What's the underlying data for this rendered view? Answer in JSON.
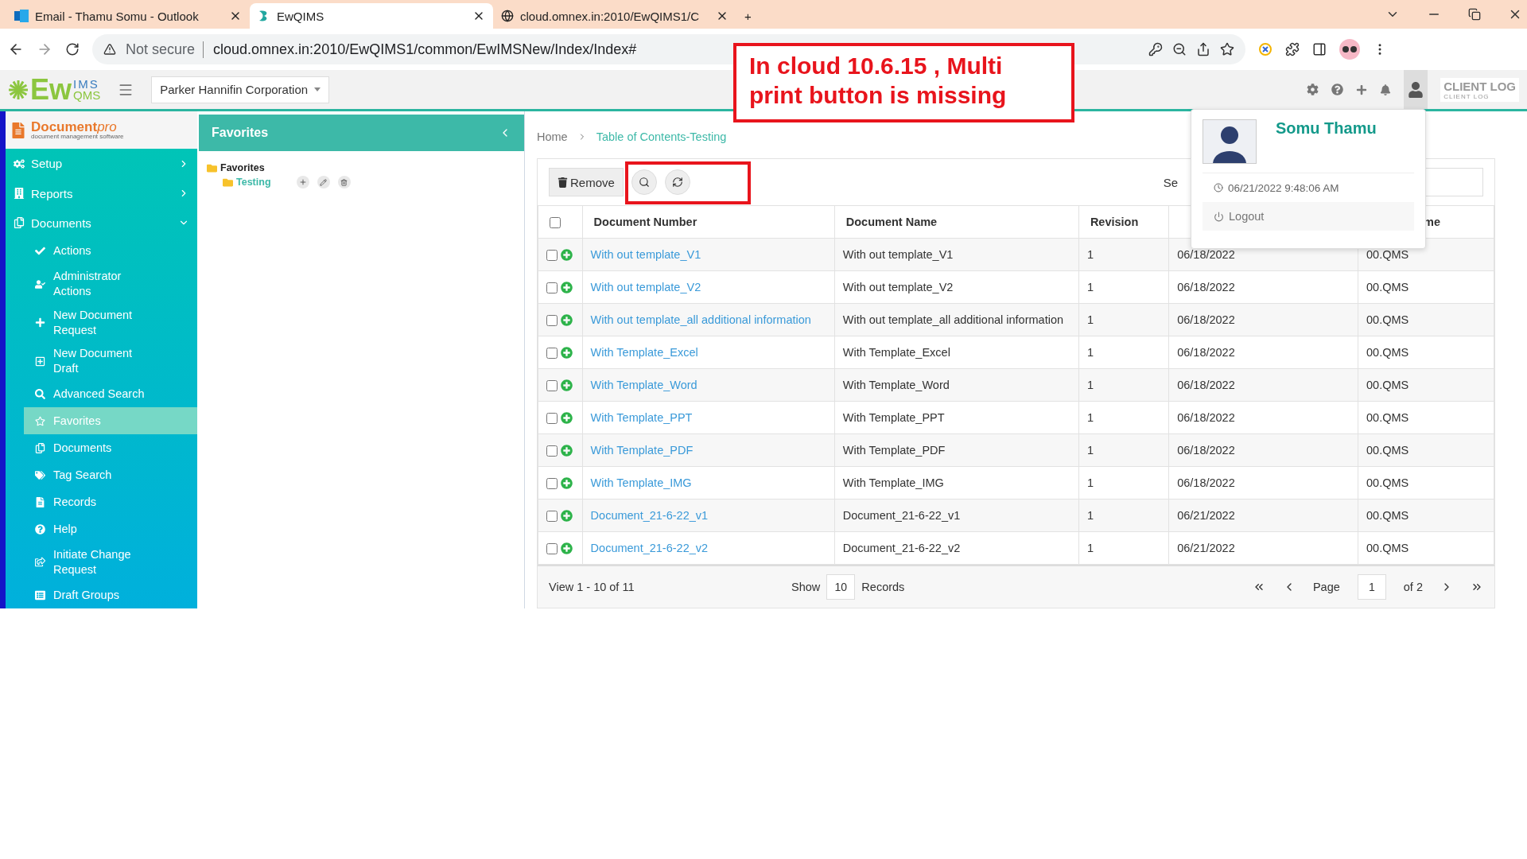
{
  "browser": {
    "tabs": [
      {
        "title": "Email - Thamu Somu - Outlook",
        "selected": false
      },
      {
        "title": "EwQIMS",
        "selected": true
      },
      {
        "title": "cloud.omnex.in:2010/EwQIMS1/C",
        "selected": false
      }
    ],
    "new_tab": "+",
    "security": "Not secure",
    "url": "cloud.omnex.in:2010/EwQIMS1/common/EwIMSNew/Index/Index#"
  },
  "annotation": {
    "text": "In cloud 10.6.15 , Multi print button is missing"
  },
  "header": {
    "logo": {
      "main": "Ew",
      "top": "IMS",
      "bottom": "QMS"
    },
    "company": "Parker Hannifin Corporation",
    "client_logo": "CLIENT LOG",
    "client_logo_tagline": "CLIENT LOG"
  },
  "sidebar": {
    "brand": {
      "name": "Document",
      "suffix": "pro",
      "tagline": "document management software"
    },
    "items": [
      {
        "label": "Setup",
        "expanded": false
      },
      {
        "label": "Reports",
        "expanded": false
      },
      {
        "label": "Documents",
        "expanded": true,
        "children": [
          {
            "label": "Actions",
            "selected": false
          },
          {
            "label": "Administrator Actions",
            "selected": false
          },
          {
            "label": "New Document Request",
            "selected": false
          },
          {
            "label": "New Document Draft",
            "selected": false
          },
          {
            "label": "Advanced Search",
            "selected": false
          },
          {
            "label": "Favorites",
            "selected": true
          },
          {
            "label": "Documents",
            "selected": false
          },
          {
            "label": "Tag Search",
            "selected": false
          },
          {
            "label": "Records",
            "selected": false
          },
          {
            "label": "Help",
            "selected": false
          },
          {
            "label": "Initiate Change Request",
            "selected": false
          },
          {
            "label": "Draft Groups",
            "selected": false
          }
        ]
      }
    ]
  },
  "favorites_panel": {
    "title": "Favorites",
    "tree": [
      {
        "label": "Favorites",
        "children": [
          {
            "label": "Testing"
          }
        ]
      }
    ]
  },
  "breadcrumb": [
    "Home",
    "Table of Contents-Testing"
  ],
  "toolbar": {
    "remove": "Remove",
    "search_label": "Se"
  },
  "table": {
    "select_all_checked": false,
    "columns": [
      {
        "label": "Document Number"
      },
      {
        "label": "Document Name"
      },
      {
        "label": "Revision"
      },
      {},
      {
        "label": "me"
      }
    ],
    "rows": [
      {
        "checked": false,
        "cells": [
          "With out template_V1",
          "With out template_V1",
          "1",
          "06/18/2022",
          "00.QMS"
        ]
      },
      {
        "checked": false,
        "cells": [
          "With out template_V2",
          "With out template_V2",
          "1",
          "06/18/2022",
          "00.QMS"
        ]
      },
      {
        "checked": false,
        "cells": [
          "With out template_all additional information",
          "With out template_all additional information",
          "1",
          "06/18/2022",
          "00.QMS"
        ]
      },
      {
        "checked": false,
        "cells": [
          "With Template_Excel",
          "With Template_Excel",
          "1",
          "06/18/2022",
          "00.QMS"
        ]
      },
      {
        "checked": false,
        "cells": [
          "With Template_Word",
          "With Template_Word",
          "1",
          "06/18/2022",
          "00.QMS"
        ]
      },
      {
        "checked": false,
        "cells": [
          "With Template_PPT",
          "With Template_PPT",
          "1",
          "06/18/2022",
          "00.QMS"
        ]
      },
      {
        "checked": false,
        "cells": [
          "With Template_PDF",
          "With Template_PDF",
          "1",
          "06/18/2022",
          "00.QMS"
        ]
      },
      {
        "checked": false,
        "cells": [
          "With Template_IMG",
          "With Template_IMG",
          "1",
          "06/18/2022",
          "00.QMS"
        ]
      },
      {
        "checked": false,
        "cells": [
          "Document_21-6-22_v1",
          "Document_21-6-22_v1",
          "1",
          "06/21/2022",
          "00.QMS"
        ]
      },
      {
        "checked": false,
        "cells": [
          "Document_21-6-22_v2",
          "Document_21-6-22_v2",
          "1",
          "06/21/2022",
          "00.QMS"
        ]
      }
    ]
  },
  "pager": {
    "view": "View 1 - 10 of 11",
    "show": "Show",
    "page_size": "10",
    "records": "Records",
    "page_label": "Page",
    "page": "1",
    "of": "of 2"
  },
  "user_menu": {
    "name": "Somu Thamu",
    "login_time": "06/21/2022 9:48:06 AM",
    "logout": "Logout"
  }
}
